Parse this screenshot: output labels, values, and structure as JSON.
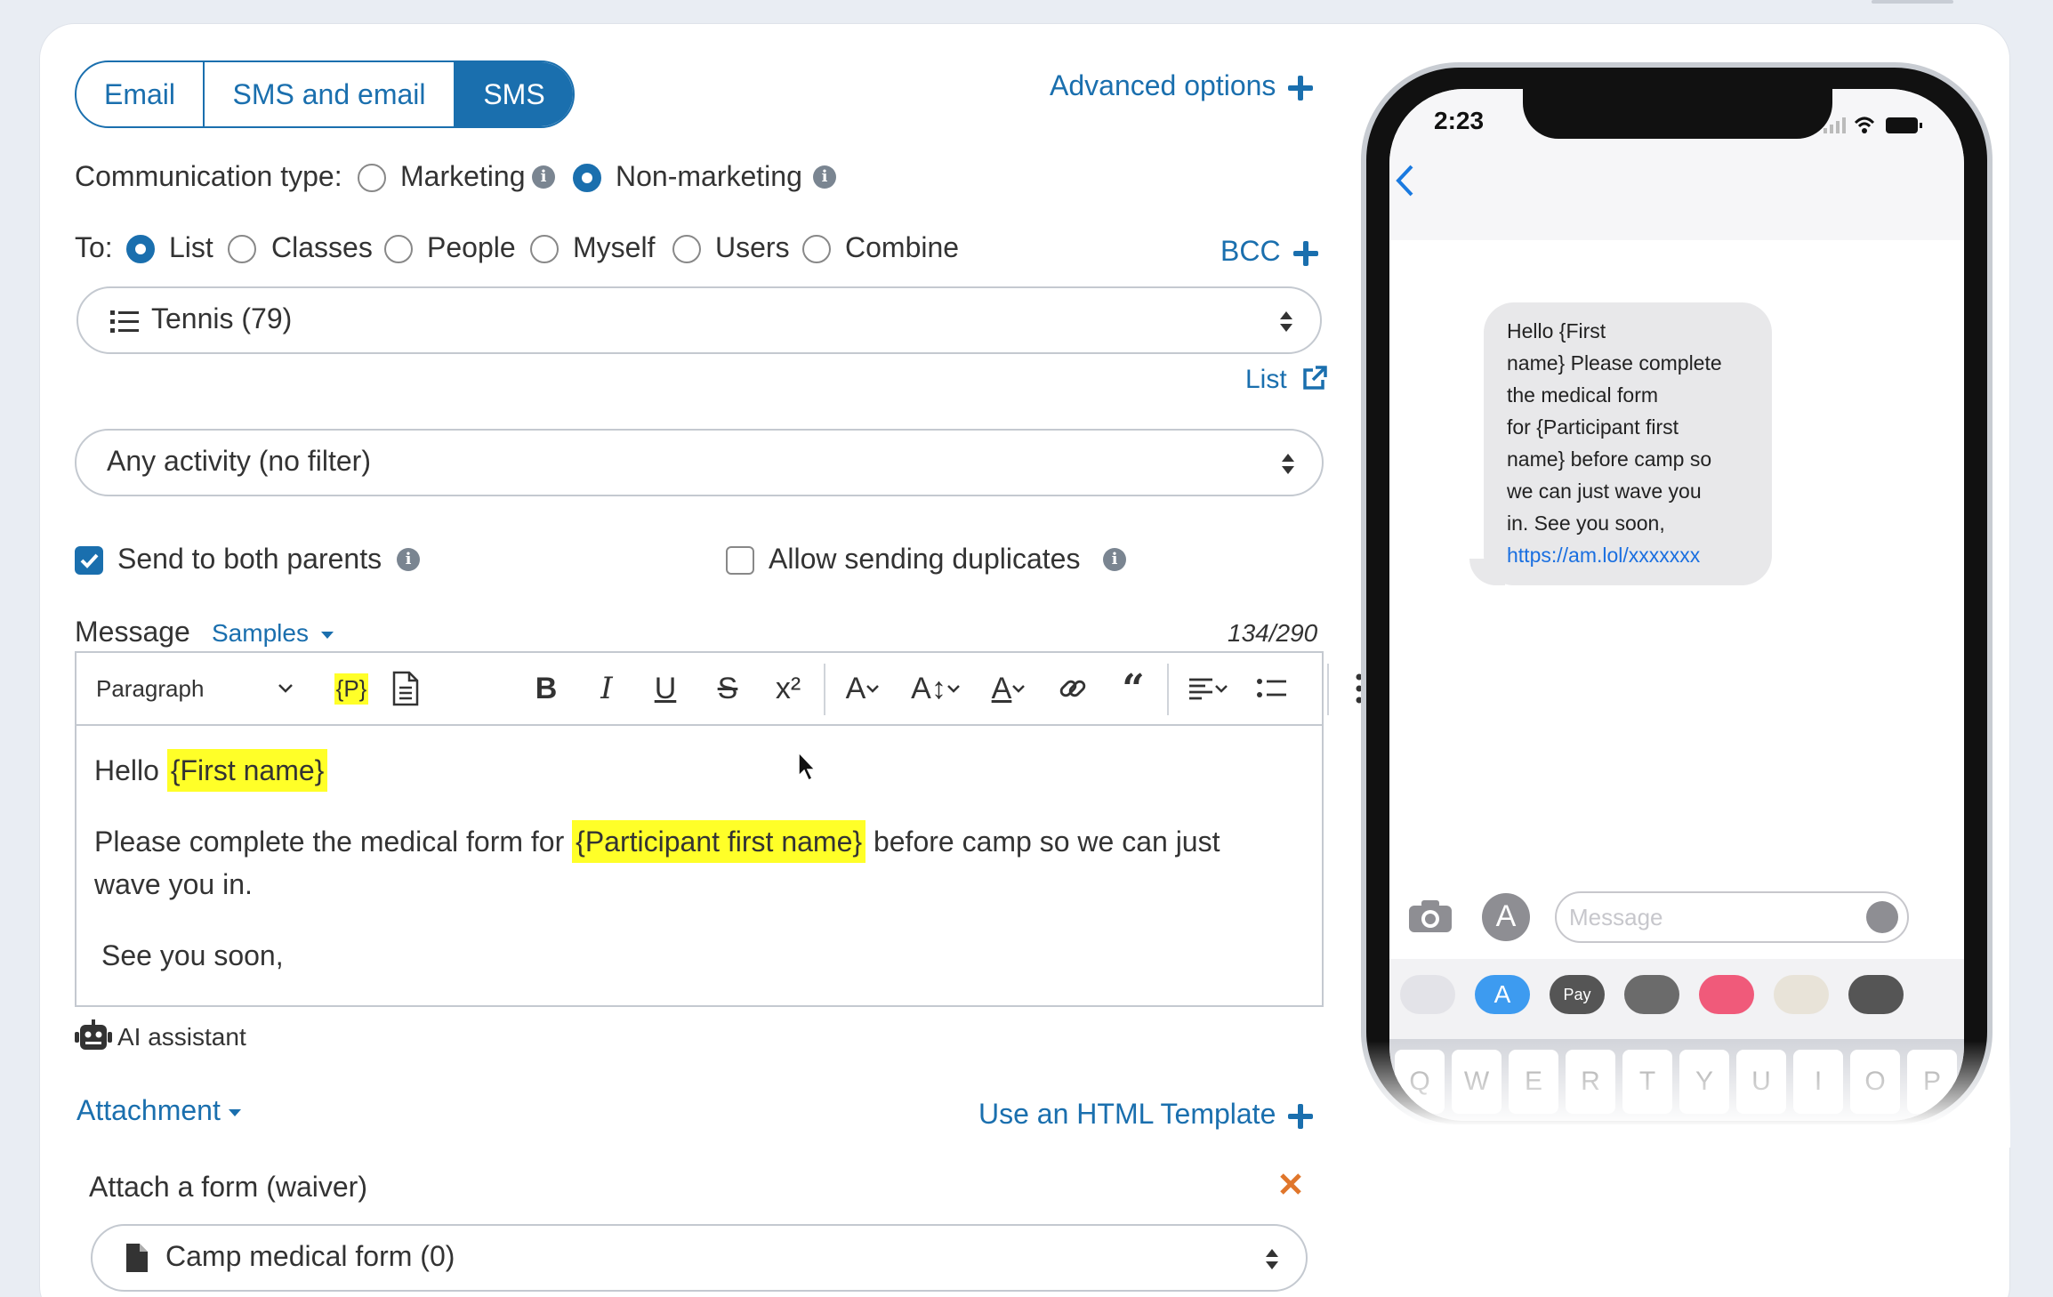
{
  "tabs": [
    {
      "label": "Email",
      "active": false
    },
    {
      "label": "SMS and email",
      "active": false
    },
    {
      "label": "SMS",
      "active": true
    }
  ],
  "advanced_options": "Advanced options",
  "comm_type": {
    "label": "Communication type:",
    "options": [
      {
        "label": "Marketing",
        "selected": false
      },
      {
        "label": "Non-marketing",
        "selected": true
      }
    ]
  },
  "to": {
    "label": "To:",
    "options": [
      {
        "label": "List",
        "selected": true
      },
      {
        "label": "Classes",
        "selected": false
      },
      {
        "label": "People",
        "selected": false
      },
      {
        "label": "Myself",
        "selected": false
      },
      {
        "label": "Users",
        "selected": false
      },
      {
        "label": "Combine",
        "selected": false
      }
    ],
    "bcc": "BCC"
  },
  "list_select": {
    "value": "Tennis (79)"
  },
  "list_link": "List",
  "activity_select": {
    "value": "Any activity (no filter)"
  },
  "send_both_parents": {
    "label": "Send to both parents",
    "checked": true
  },
  "allow_duplicates": {
    "label": "Allow sending duplicates",
    "checked": false
  },
  "message": {
    "label": "Message",
    "samples": "Samples",
    "counter": "134/290"
  },
  "toolbar": {
    "paragraph": "Paragraph",
    "placeholder_icon": "{P}"
  },
  "editor": {
    "line1_pre": "Hello",
    "line1_tag": "{First name}",
    "line2_pre": "Please complete the medical form for",
    "line2_tag": "{Participant first name}",
    "line2_post": "before camp so we can just",
    "line3": "wave you in.",
    "line4": "See you soon,"
  },
  "ai_assistant": "AI assistant",
  "attachment": "Attachment",
  "html_template": "Use an HTML Template",
  "attach_form": {
    "label": "Attach a form (waiver)",
    "value": "Camp medical form (0)"
  },
  "phone": {
    "time": "2:23",
    "bubble_lines": [
      "Hello {First",
      "name} Please complete",
      "the medical form",
      "for {Participant first",
      "name} before camp so",
      "we can just wave you",
      "in. See you soon,"
    ],
    "bubble_link": "https://am.lol/xxxxxxx",
    "message_placeholder": "Message",
    "keys": [
      "Q",
      "W",
      "E",
      "R",
      "T",
      "Y",
      "U",
      "I",
      "O",
      "P"
    ],
    "apple_pay": "Pay"
  },
  "colors": {
    "accent": "#1a6fae",
    "highlight": "#ffff28",
    "danger": "#e0762b"
  }
}
